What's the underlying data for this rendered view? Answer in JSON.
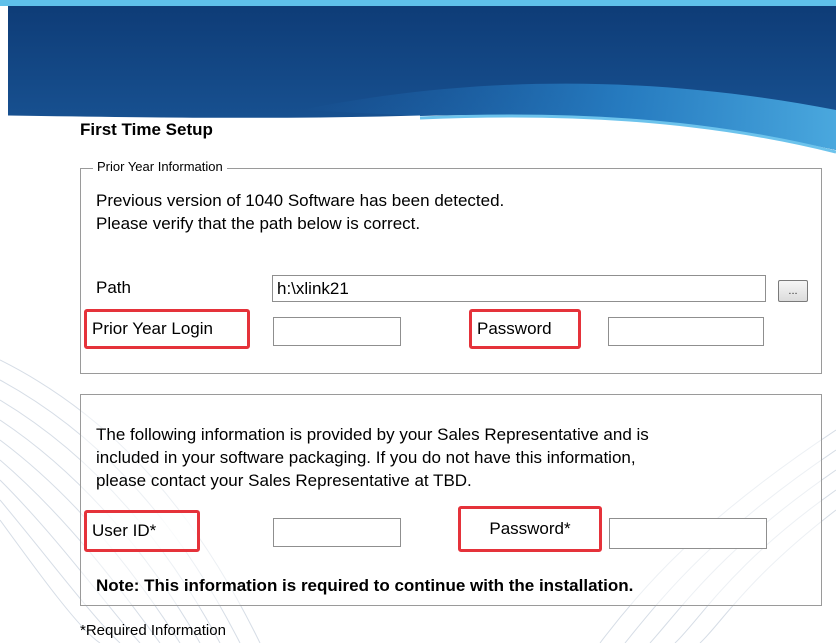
{
  "window": {
    "title": "First Time Setup"
  },
  "prior_year": {
    "legend": "Prior Year Information",
    "message_line1": "Previous version of 1040 Software has been detected.",
    "message_line2": "Please verify that the path below is correct.",
    "path_label": "Path",
    "path_value": "h:\\xlink21",
    "browse_label": "...",
    "login_label": "Prior Year Login",
    "login_value": "",
    "password_label": "Password",
    "password_value": ""
  },
  "credentials": {
    "message_line1": "The following information is provided by your Sales Representative and is",
    "message_line2": "included in your software packaging. If you do not have this information,",
    "message_line3": "please contact your Sales Representative at TBD.",
    "userid_label": "User ID*",
    "userid_value": "",
    "password_label": "Password*",
    "password_value": "",
    "note": "Note: This information is required to continue with the installation."
  },
  "footer": {
    "required_note": "*Required Information"
  },
  "colors": {
    "banner_dark": "#0c3a73",
    "banner_mid": "#1f6bb5",
    "banner_light": "#5fc0ea",
    "highlight": "#e5323a"
  }
}
